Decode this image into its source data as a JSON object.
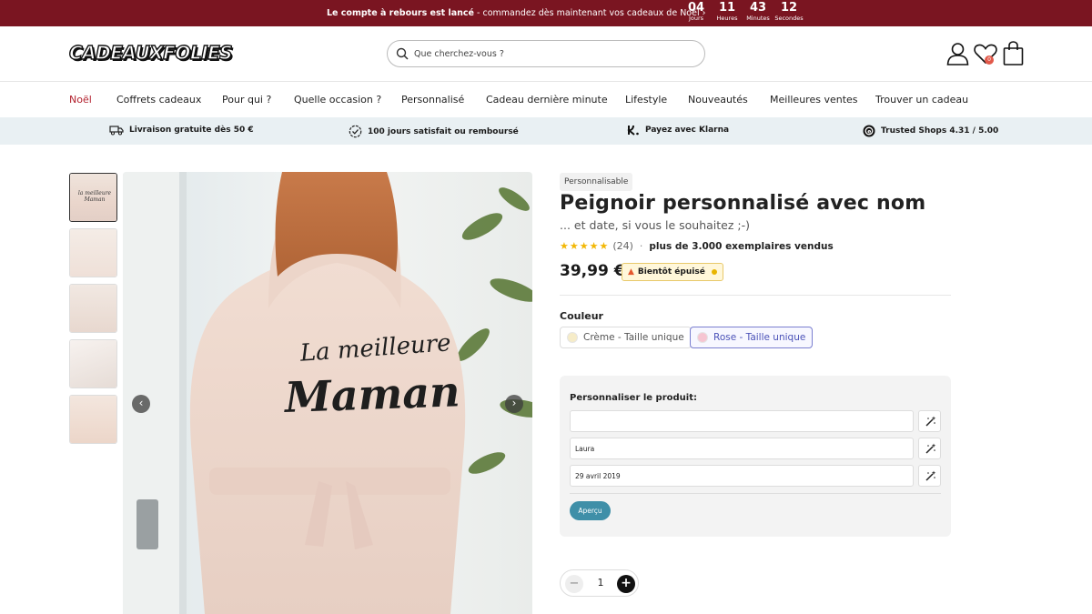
{
  "banner": {
    "bold": "Le compte à rebours est lancé",
    "text": " - commandez dès maintenant vos cadeaux de Noël ›",
    "countdown": [
      {
        "value": "04",
        "label": "Jours"
      },
      {
        "value": "11",
        "label": "Heures"
      },
      {
        "value": "43",
        "label": "Minutes"
      },
      {
        "value": "12",
        "label": "Secondes"
      }
    ]
  },
  "header": {
    "logo": "CADEAUXFOLIES",
    "search_placeholder": "Que cherchez-vous ?",
    "wishlist_count": "0"
  },
  "nav": [
    "Noël",
    "Coffrets cadeaux",
    "Pour qui ?",
    "Quelle occasion ?",
    "Personnalisé",
    "Cadeau dernière minute",
    "Lifestyle",
    "Nouveautés",
    "Meilleures ventes",
    "Trouver un cadeau"
  ],
  "usp": [
    {
      "icon": "truck-icon",
      "label": "Livraison gratuite dès 50 €"
    },
    {
      "icon": "refund-icon",
      "label": "100 jours satisfait ou remboursé"
    },
    {
      "icon": "klarna-icon",
      "label": "Payez avec Klarna"
    },
    {
      "icon": "trusted-shops-icon",
      "label": "Trusted Shops 4.31 / 5.00"
    }
  ],
  "product": {
    "tag": "Personnalisable",
    "title": "Peignoir personnalisé avec nom",
    "subtitle": "... et date, si vous le souhaitez ;-)",
    "stars": "★★★★★",
    "rating_count": "(24)",
    "separator": "·",
    "sold": "plus de 3.000 exemplaires vendus",
    "price": "39,99 €",
    "stock_badge": "Bientôt épuisé",
    "image_text_line1": "La meilleure",
    "image_text_line2": "Maman",
    "thumb_text": "la meilleure Maman",
    "color_label": "Couleur",
    "colors": [
      {
        "label": "Crème - Taille unique",
        "swatch": "#f6ecc8",
        "selected": false
      },
      {
        "label": "Rose - Taille unique",
        "swatch": "#f6c5d2",
        "selected": true
      }
    ],
    "personalize": {
      "title": "Personnaliser le produit:",
      "fields": [
        "",
        "Laura",
        "29 avril 2019"
      ],
      "preview_button": "Aperçu"
    },
    "quantity": "1"
  },
  "colors": {
    "banner_bg": "#7a1521",
    "active_nav": "#b3222f",
    "usp_bg": "#e9f0f3",
    "preview_button": "#3f8fa8",
    "star": "#f2b705"
  }
}
